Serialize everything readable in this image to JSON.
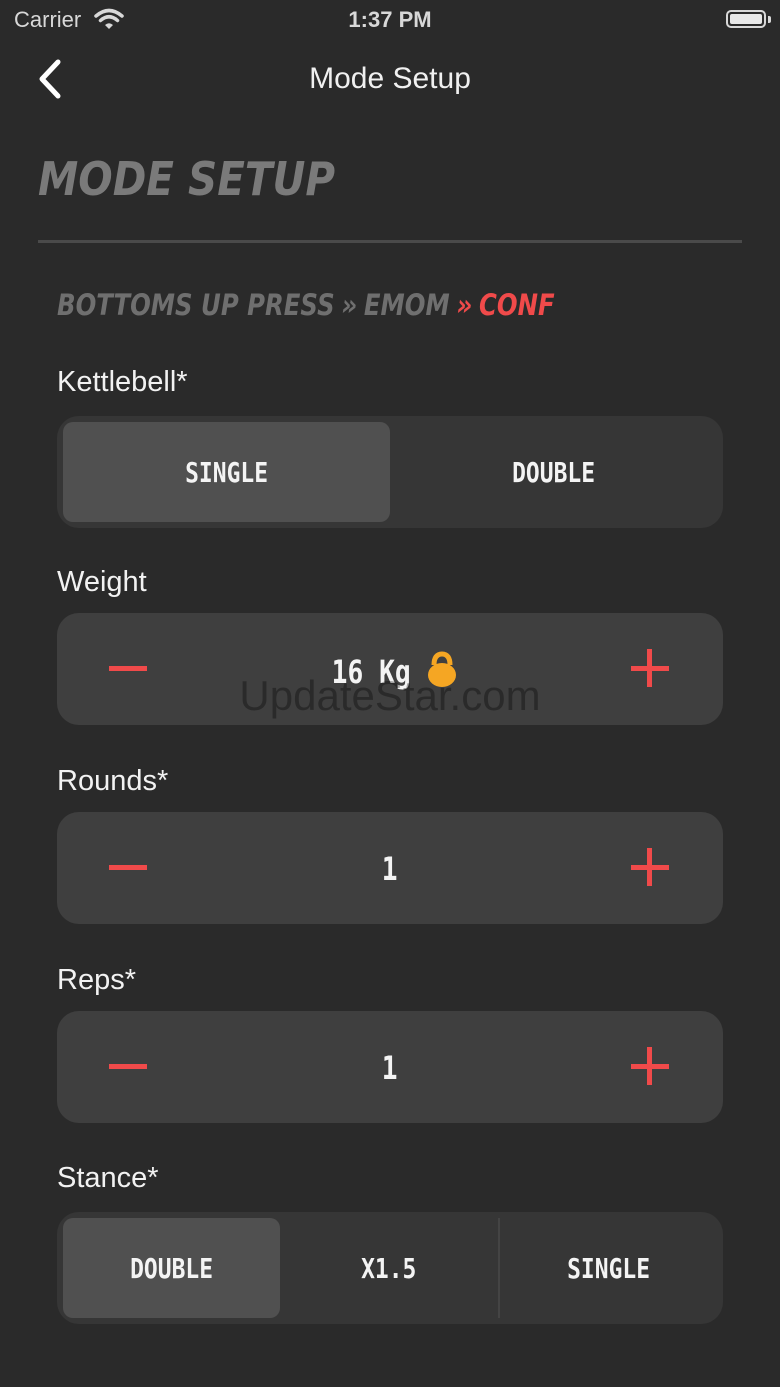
{
  "status": {
    "carrier": "Carrier",
    "time": "1:37 PM"
  },
  "nav": {
    "title": "Mode Setup"
  },
  "heading": "MODE SETUP",
  "breadcrumb": {
    "item1": "BOTTOMS UP PRESS",
    "item2": "EMOM",
    "item3": "CONF",
    "separator": "»"
  },
  "kettlebell": {
    "label": "Kettlebell*",
    "options": [
      "SINGLE",
      "DOUBLE"
    ],
    "selected": "SINGLE"
  },
  "weight": {
    "label": "Weight",
    "value": "16 Kg",
    "icon": "kettlebell-icon"
  },
  "rounds": {
    "label": "Rounds*",
    "value": "1"
  },
  "reps": {
    "label": "Reps*",
    "value": "1"
  },
  "stance": {
    "label": "Stance*",
    "options": [
      "DOUBLE",
      "X1.5",
      "SINGLE"
    ],
    "selected": "DOUBLE"
  },
  "watermark": "UpdateStar.com",
  "colors": {
    "accent": "#f04a4a",
    "background": "#2a2a2a",
    "icon": "#f5a623"
  }
}
